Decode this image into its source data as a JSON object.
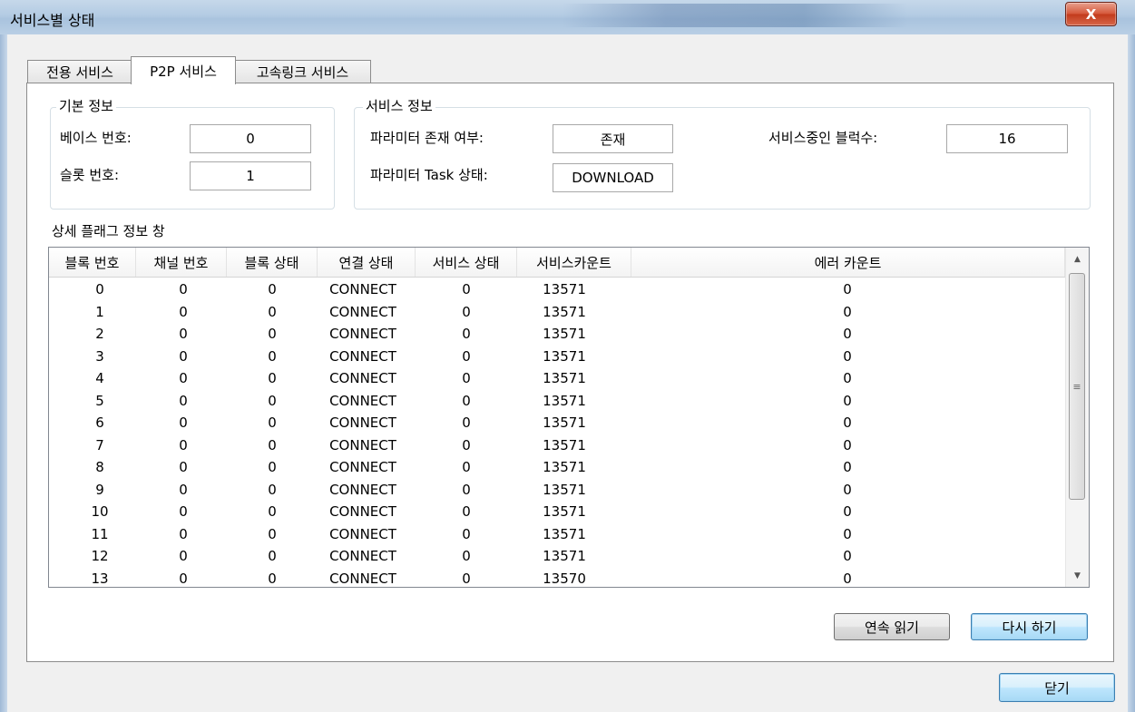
{
  "window": {
    "title": "서비스별 상태",
    "close_label": "X"
  },
  "tabs": [
    {
      "label": "전용 서비스"
    },
    {
      "label": "P2P 서비스"
    },
    {
      "label": "고속링크 서비스"
    }
  ],
  "basic_info": {
    "legend": "기본 정보",
    "base_label": "베이스 번호:",
    "base_value": "0",
    "slot_label": "슬롯 번호:",
    "slot_value": "1"
  },
  "service_info": {
    "legend": "서비스 정보",
    "param_exists_label": "파라미터 존재 여부:",
    "param_exists_value": "존재",
    "param_task_label": "파라미터 Task 상태:",
    "param_task_value": "DOWNLOAD",
    "blocks_label": "서비스중인 블럭수:",
    "blocks_value": "16"
  },
  "detail": {
    "title": "상세 플래그 정보 창",
    "columns": [
      "블록 번호",
      "채널 번호",
      "블록 상태",
      "연결 상태",
      "서비스 상태",
      "서비스카운트",
      "에러 카운트"
    ],
    "rows": [
      [
        "0",
        "0",
        "0",
        "CONNECT",
        "0",
        "13571",
        "0"
      ],
      [
        "1",
        "0",
        "0",
        "CONNECT",
        "0",
        "13571",
        "0"
      ],
      [
        "2",
        "0",
        "0",
        "CONNECT",
        "0",
        "13571",
        "0"
      ],
      [
        "3",
        "0",
        "0",
        "CONNECT",
        "0",
        "13571",
        "0"
      ],
      [
        "4",
        "0",
        "0",
        "CONNECT",
        "0",
        "13571",
        "0"
      ],
      [
        "5",
        "0",
        "0",
        "CONNECT",
        "0",
        "13571",
        "0"
      ],
      [
        "6",
        "0",
        "0",
        "CONNECT",
        "0",
        "13571",
        "0"
      ],
      [
        "7",
        "0",
        "0",
        "CONNECT",
        "0",
        "13571",
        "0"
      ],
      [
        "8",
        "0",
        "0",
        "CONNECT",
        "0",
        "13571",
        "0"
      ],
      [
        "9",
        "0",
        "0",
        "CONNECT",
        "0",
        "13571",
        "0"
      ],
      [
        "10",
        "0",
        "0",
        "CONNECT",
        "0",
        "13571",
        "0"
      ],
      [
        "11",
        "0",
        "0",
        "CONNECT",
        "0",
        "13571",
        "0"
      ],
      [
        "12",
        "0",
        "0",
        "CONNECT",
        "0",
        "13571",
        "0"
      ],
      [
        "13",
        "0",
        "0",
        "CONNECT",
        "0",
        "13570",
        "0"
      ]
    ]
  },
  "buttons": {
    "continuous_read": "연속 읽기",
    "retry": "다시 하기",
    "close": "닫기"
  },
  "icons": {
    "scroll_up": "scroll-up-arrow-icon",
    "scroll_down": "scroll-down-arrow-icon",
    "grip": "scrollbar-grip-icon"
  }
}
